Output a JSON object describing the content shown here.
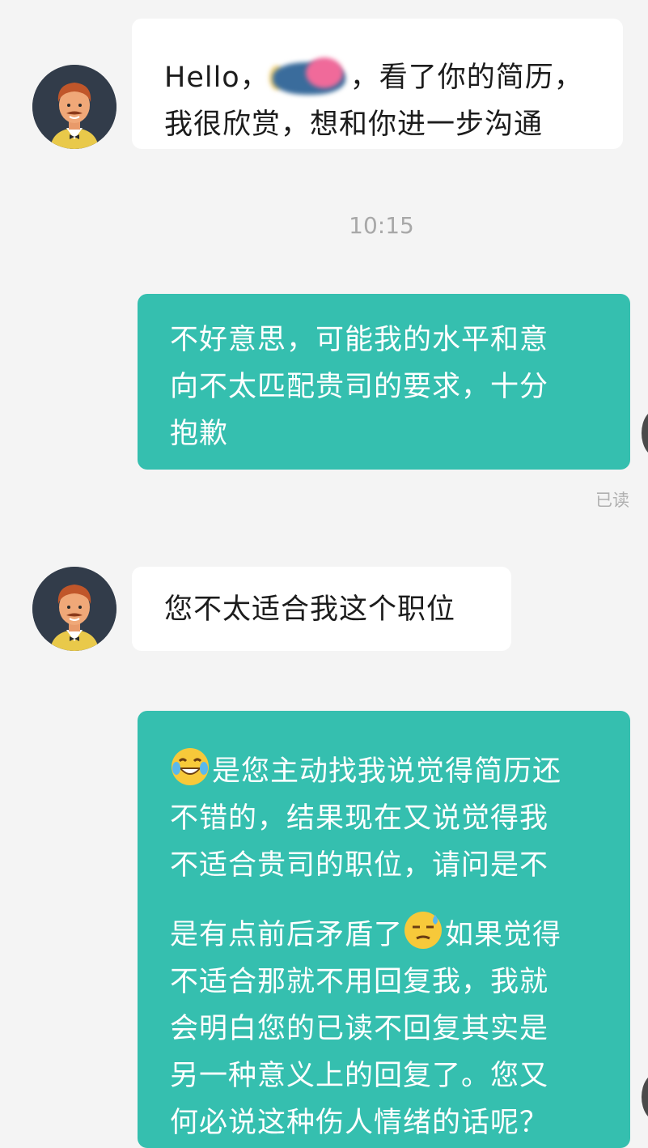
{
  "chat": {
    "messages": [
      {
        "from": "recruiter",
        "line1_prefix": "Hello，",
        "line1_suffix": "，看了你的简历，",
        "line2": "我很欣赏，想和你进一步沟通"
      },
      {
        "from": "me",
        "lines": [
          "不好意思，可能我的水平和意",
          "向不太匹配贵司的要求，十分",
          "抱歉"
        ]
      },
      {
        "from": "recruiter",
        "lines": [
          "您不太适合我这个职位"
        ]
      },
      {
        "from": "me",
        "lines": [
          "是您主动找我说觉得简历还",
          "不错的，结果现在又说觉得我",
          "不适合贵司的职位，请问是不",
          "是有点前后矛盾了",
          "如果觉得",
          "不适合那就不用回复我，我就",
          "会明白您的已读不回复其实是",
          "另一种意义上的回复了。您又",
          "何必说这种伤人情绪的话呢？"
        ]
      }
    ],
    "timestamp": "10:15",
    "read_status": "已读",
    "icons": {
      "avatar": "man-with-mustache-avatar",
      "emoji_1": "laughing-tears-emoji",
      "emoji_2": "unamused-sweat-emoji"
    },
    "colors": {
      "outgoing_bubble": "#35bfaf",
      "incoming_bubble": "#ffffff",
      "background": "#f4f4f4"
    }
  }
}
